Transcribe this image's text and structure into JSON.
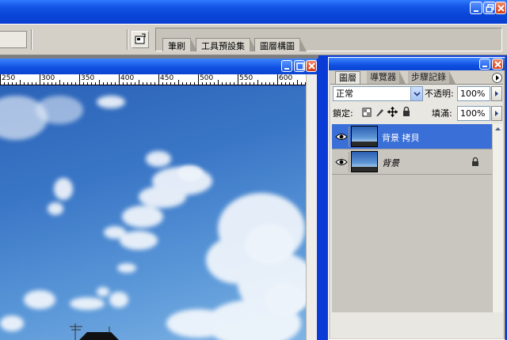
{
  "options_bar": {
    "well_tabs": [
      "筆刷",
      "工具預設集",
      "圖層構圖"
    ]
  },
  "ruler": {
    "labels": [
      "250",
      "300",
      "350",
      "400",
      "450",
      "500",
      "550",
      "600"
    ]
  },
  "layers_panel": {
    "tabs": [
      "圖層",
      "導覽器",
      "步驟記錄"
    ],
    "blend_mode": "正常",
    "opacity_label": "不透明:",
    "opacity_value": "100%",
    "lock_label": "鎖定:",
    "fill_label": "填滿:",
    "fill_value": "100%",
    "layers": [
      {
        "name": "背景 拷貝",
        "selected": true,
        "visible": true,
        "locked": false
      },
      {
        "name": "背景",
        "selected": false,
        "visible": true,
        "locked": true,
        "italic": true
      }
    ]
  },
  "colors": {
    "xp_blue": "#0a3bd6",
    "panel_gray": "#d4d0c8",
    "selection_blue": "#3a6fd8",
    "close_red": "#d33a12"
  }
}
